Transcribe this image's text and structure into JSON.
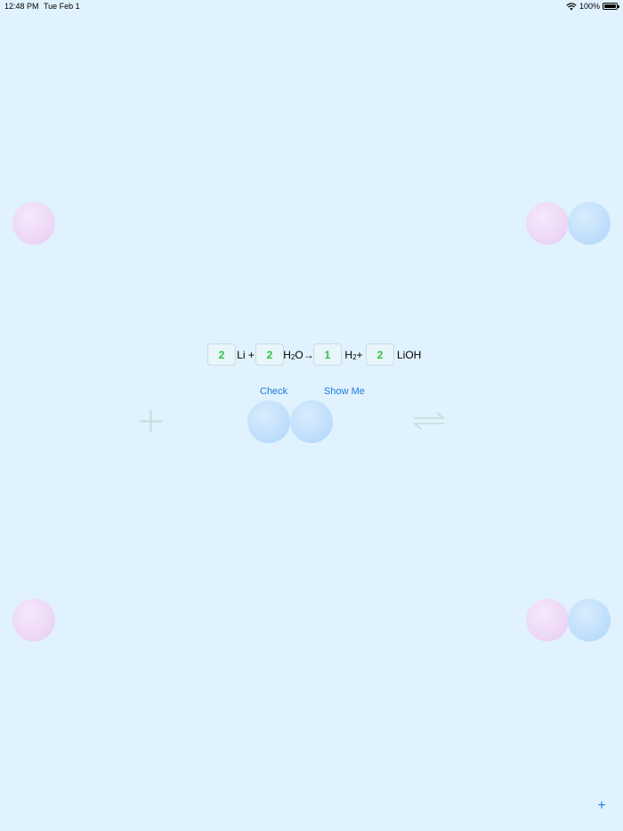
{
  "status_bar": {
    "time": "12:48 PM",
    "date": "Tue Feb 1",
    "battery": "100%",
    "icons": [
      "wifi-icon",
      "battery-icon"
    ]
  },
  "equation": {
    "coef_li": "2",
    "li": "Li +",
    "coef_h2o": "2",
    "h2o_h": "H",
    "h2o_sub": "2",
    "h2o_o": "O",
    "arrow": "→",
    "coef_h2": "1",
    "h2_h": "H",
    "h2_sub": "2",
    "h2_plus": " +",
    "coef_lioh": "2",
    "lioh": "LiOH"
  },
  "controls": {
    "check_label": "Check",
    "show_me_label": "Show Me",
    "add_label": "+"
  },
  "icons": {
    "plus_symbol": "plus-icon",
    "equilibrium_symbol": "equilibrium-arrows-icon"
  },
  "colors": {
    "background": "#e0f2fd",
    "coefficient_text": "#2fbf3b",
    "link": "#1e7be0",
    "atom_pink": "#eed9f6",
    "atom_blue": "#c2e0fb"
  }
}
